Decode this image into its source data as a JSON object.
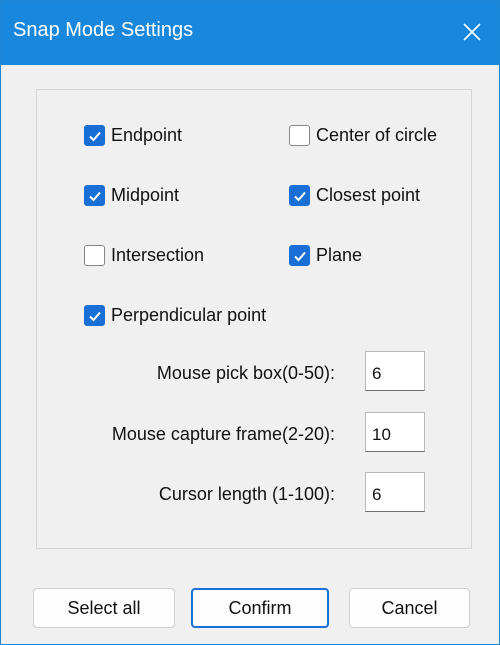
{
  "window": {
    "title": "Snap Mode Settings"
  },
  "options": {
    "endpoint": {
      "label": "Endpoint",
      "checked": true
    },
    "center_of_circle": {
      "label": "Center of circle",
      "checked": false
    },
    "midpoint": {
      "label": "Midpoint",
      "checked": true
    },
    "closest_point": {
      "label": "Closest point",
      "checked": true
    },
    "intersection": {
      "label": "Intersection",
      "checked": false
    },
    "plane": {
      "label": "Plane",
      "checked": true
    },
    "perpendicular_point": {
      "label": "Perpendicular point",
      "checked": true
    }
  },
  "fields": {
    "pick_box": {
      "label": "Mouse pick box(0-50):",
      "value": "6"
    },
    "capture_frame": {
      "label": "Mouse capture frame(2-20):",
      "value": "10"
    },
    "cursor_length": {
      "label": "Cursor length (1-100):",
      "value": "6"
    }
  },
  "buttons": {
    "select_all": "Select all",
    "confirm": "Confirm",
    "cancel": "Cancel"
  },
  "colors": {
    "title_bar": "#1987dc",
    "accent": "#1a6fd6",
    "dialog_bg": "#f0f0f0"
  },
  "icons": {
    "close": "close-icon",
    "check": "checkmark-icon"
  }
}
